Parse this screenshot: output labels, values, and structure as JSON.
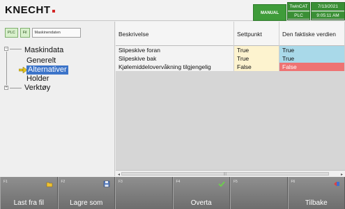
{
  "header": {
    "logo": "KNECHT",
    "mode": "MANUAL",
    "status": [
      {
        "top": "TwinCAT",
        "bottom": "PLC"
      },
      {
        "top": "7/13/2021",
        "bottom": "9:05:11 AM"
      }
    ]
  },
  "left_toolbar": {
    "plc": "PLC",
    "file": "Fil",
    "machine_data": "Maskinendaten"
  },
  "tree": {
    "root": "Maskindata",
    "items": [
      "Generelt",
      "Alternativer",
      "Holder",
      "Verktøy"
    ],
    "selected": "Alternativer"
  },
  "grid": {
    "columns": [
      "Beskrivelse",
      "Settpunkt",
      "Den faktiske verdien"
    ],
    "rows": [
      {
        "desc": "Slipeskive foran",
        "setpoint": "True",
        "actual": "True",
        "status": "ok"
      },
      {
        "desc": "Slipeskive bak",
        "setpoint": "True",
        "actual": "True",
        "status": "ok"
      },
      {
        "desc": "Kjølemiddelovervåkning tilgjengelig",
        "setpoint": "False",
        "actual": "False",
        "status": "bad"
      }
    ]
  },
  "fkeys": [
    {
      "num": "F1",
      "label": "Last fra fil",
      "icon": "folder-icon"
    },
    {
      "num": "F2",
      "label": "Lagre som",
      "icon": "save-icon"
    },
    {
      "num": "F3",
      "label": "",
      "icon": ""
    },
    {
      "num": "F4",
      "label": "Overta",
      "icon": "checkmark-icon"
    },
    {
      "num": "F5",
      "label": "",
      "icon": ""
    },
    {
      "num": "F6",
      "label": "Tilbake",
      "icon": "back-arrow-icon"
    }
  ],
  "colors": {
    "mode_green": "#3f9c3a",
    "selection_blue": "#3c74c9",
    "actual_ok": "#a9d9e9",
    "actual_bad": "#ee7373",
    "setpoint_bg": "#fdf3cf",
    "logo_accent": "#d32626"
  }
}
